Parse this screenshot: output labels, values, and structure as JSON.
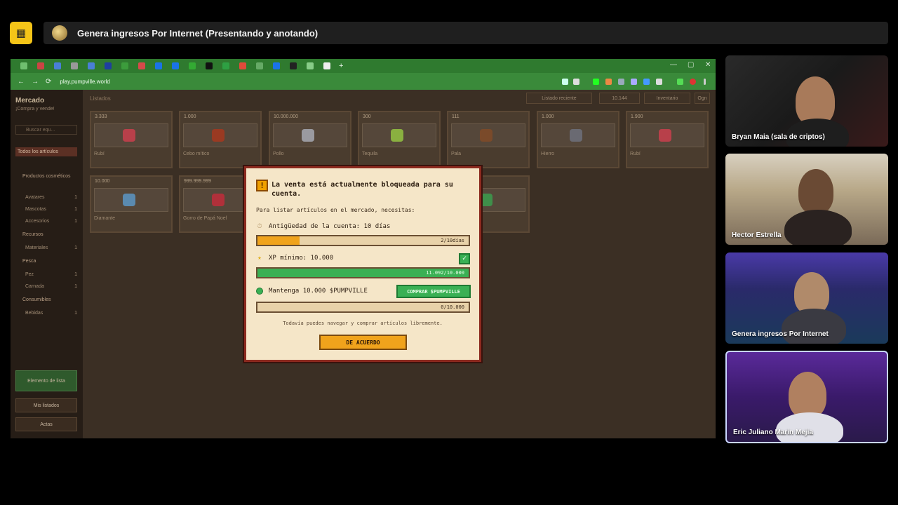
{
  "meet": {
    "title": "Genera ingresos Por Internet (Presentando y anotando)"
  },
  "browser": {
    "url": "play.pumpville.world",
    "new_tab": "+",
    "nav_back": "←",
    "nav_forward": "→",
    "nav_reload": "⟳",
    "win_minimize": "—",
    "win_maximize": "▢",
    "win_close": "✕"
  },
  "app": {
    "sidebar": {
      "title": "Mercado",
      "subtitle": "¡Compra y vende!",
      "search_placeholder": "Buscar equ...",
      "categories": [
        {
          "label": "Todos los artículos",
          "count": ""
        },
        {
          "label": "Productos cosméticos",
          "count": ""
        },
        {
          "label": "Avatares",
          "count": "1"
        },
        {
          "label": "Mascotas",
          "count": "1"
        },
        {
          "label": "Accesorios",
          "count": "1"
        },
        {
          "label": "Recursos",
          "count": ""
        },
        {
          "label": "Materiales",
          "count": "1"
        },
        {
          "label": "Pesca",
          "count": ""
        },
        {
          "label": "Pez",
          "count": "1"
        },
        {
          "label": "Carnada",
          "count": "1"
        },
        {
          "label": "Consumibles",
          "count": ""
        },
        {
          "label": "Bebidas",
          "count": "1"
        }
      ],
      "btn_list_item": "Elemento de lista",
      "btn_my_listings": "Mis listados",
      "btn_activity": "Actas"
    },
    "topbar": {
      "listings_label": "Listados",
      "sort_label": "Listado reciente",
      "balance": "10.144",
      "inventory_label": "Inventario",
      "login_label": "Ogn"
    },
    "cards": [
      {
        "price": "3.333",
        "name": "Rubí"
      },
      {
        "price": "1.000",
        "name": "Cebo mítico"
      },
      {
        "price": "10.000.000",
        "name": "Pollo"
      },
      {
        "price": "300",
        "name": "Tequila"
      },
      {
        "price": "111",
        "name": "Pala"
      },
      {
        "price": "1.000",
        "name": "Hierro"
      },
      {
        "price": "1.900",
        "name": "Rubí"
      },
      {
        "price": "10.000",
        "name": "Diamante"
      },
      {
        "price": "999.999.999",
        "name": "Gorro de Papá Noel"
      },
      {
        "price": "",
        "name": "n"
      }
    ],
    "card_icon_colors": [
      "#b8404a",
      "#9a3a22",
      "#9a9aa0",
      "#8ab040",
      "#7a4a2a",
      "#6a6a72",
      "#b8404a",
      "#5a8ab0",
      "#b0303a",
      "#3f8f4a"
    ]
  },
  "modal": {
    "warn_glyph": "!",
    "title": "La venta está actualmente bloqueada para su cuenta.",
    "intro": "Para listar artículos en el mercado, necesitas:",
    "req1_label": "Antigüedad de la cuenta: 10 días",
    "req1_progress": "2/10días",
    "req1_fraction": 0.2,
    "req2_label": "XP mínimo: 10.000",
    "req2_progress": "11.092/10.000",
    "req2_fraction": 1.0,
    "req2_check": "✓",
    "req3_label": "Mantenga 10.000 $PUMPVILLE",
    "req3_progress": "0/10.000",
    "req3_fraction": 0.0,
    "buy_button": "COMPRAR $PUMPVILLE",
    "footer": "Todavía puedes navegar y comprar artículos libremente.",
    "ok_button": "DE ACUERDO",
    "colors": {
      "progress_orange": "#f0a31c",
      "progress_green": "#3ab054",
      "border": "#8c2a1f"
    }
  },
  "participants": [
    {
      "name": "Bryan Maia (sala de criptos)"
    },
    {
      "name": "Hector Estrella"
    },
    {
      "name": "Genera ingresos Por Internet"
    },
    {
      "name": "Eric Juliano Marin Mejia"
    }
  ]
}
